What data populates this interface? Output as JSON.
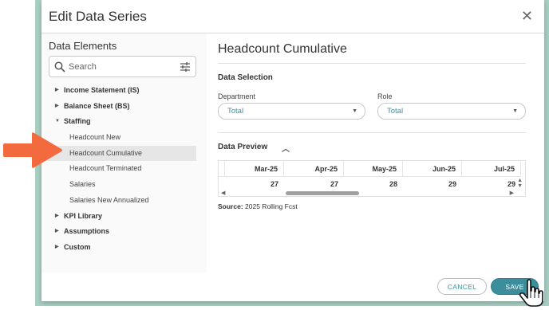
{
  "dialog": {
    "title": "Edit Data Series",
    "close_glyph": "✕"
  },
  "left_panel": {
    "title": "Data Elements",
    "search_placeholder": "Search",
    "tree": [
      {
        "label": "Income Statement (IS)",
        "type": "group",
        "expanded": false
      },
      {
        "label": "Balance Sheet (BS)",
        "type": "group",
        "expanded": false
      },
      {
        "label": "Staffing",
        "type": "group",
        "expanded": true
      },
      {
        "label": "Headcount New",
        "type": "child"
      },
      {
        "label": "Headcount Cumulative",
        "type": "child",
        "selected": true
      },
      {
        "label": "Headcount Terminated",
        "type": "child"
      },
      {
        "label": "Salaries",
        "type": "child"
      },
      {
        "label": "Salaries New Annualized",
        "type": "child"
      },
      {
        "label": "KPI Library",
        "type": "group",
        "expanded": false
      },
      {
        "label": "Assumptions",
        "type": "group",
        "expanded": false
      },
      {
        "label": "Custom",
        "type": "group",
        "expanded": false
      }
    ]
  },
  "right_panel": {
    "title": "Headcount Cumulative",
    "selection_heading": "Data Selection",
    "department": {
      "label": "Department",
      "value": "Total"
    },
    "role": {
      "label": "Role",
      "value": "Total"
    },
    "preview_heading": "Data Preview",
    "preview": {
      "columns": [
        "Mar-25",
        "Apr-25",
        "May-25",
        "Jun-25",
        "Jul-25"
      ],
      "values": [
        "27",
        "27",
        "28",
        "29",
        "29"
      ]
    },
    "source_label": "Source:",
    "source_value": "2025 Rolling Fcst"
  },
  "footer": {
    "cancel_label": "CANCEL",
    "save_label": "SAVE"
  },
  "colors": {
    "accent": "#3c8e9c",
    "highlight_arrow": "#f26a3d",
    "frame": "#a9cfc4"
  }
}
